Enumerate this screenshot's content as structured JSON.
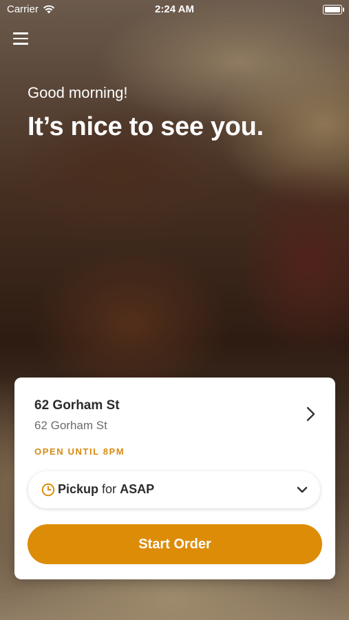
{
  "status_bar": {
    "carrier": "Carrier",
    "time": "2:24 AM",
    "wifi_icon": "wifi-icon",
    "battery_icon": "battery-icon"
  },
  "header": {
    "menu_icon": "hamburger-menu-icon",
    "greeting": "Good morning!",
    "headline": "It’s nice to see you."
  },
  "location_card": {
    "name": "62 Gorham St",
    "address": "62 Gorham St",
    "hours": "OPEN UNTIL 8PM",
    "pickup": {
      "mode": "Pickup",
      "connector": "for",
      "time": "ASAP"
    },
    "start_order_label": "Start Order"
  },
  "colors": {
    "accent": "#dd8c08",
    "hours_text": "#d88a12"
  }
}
